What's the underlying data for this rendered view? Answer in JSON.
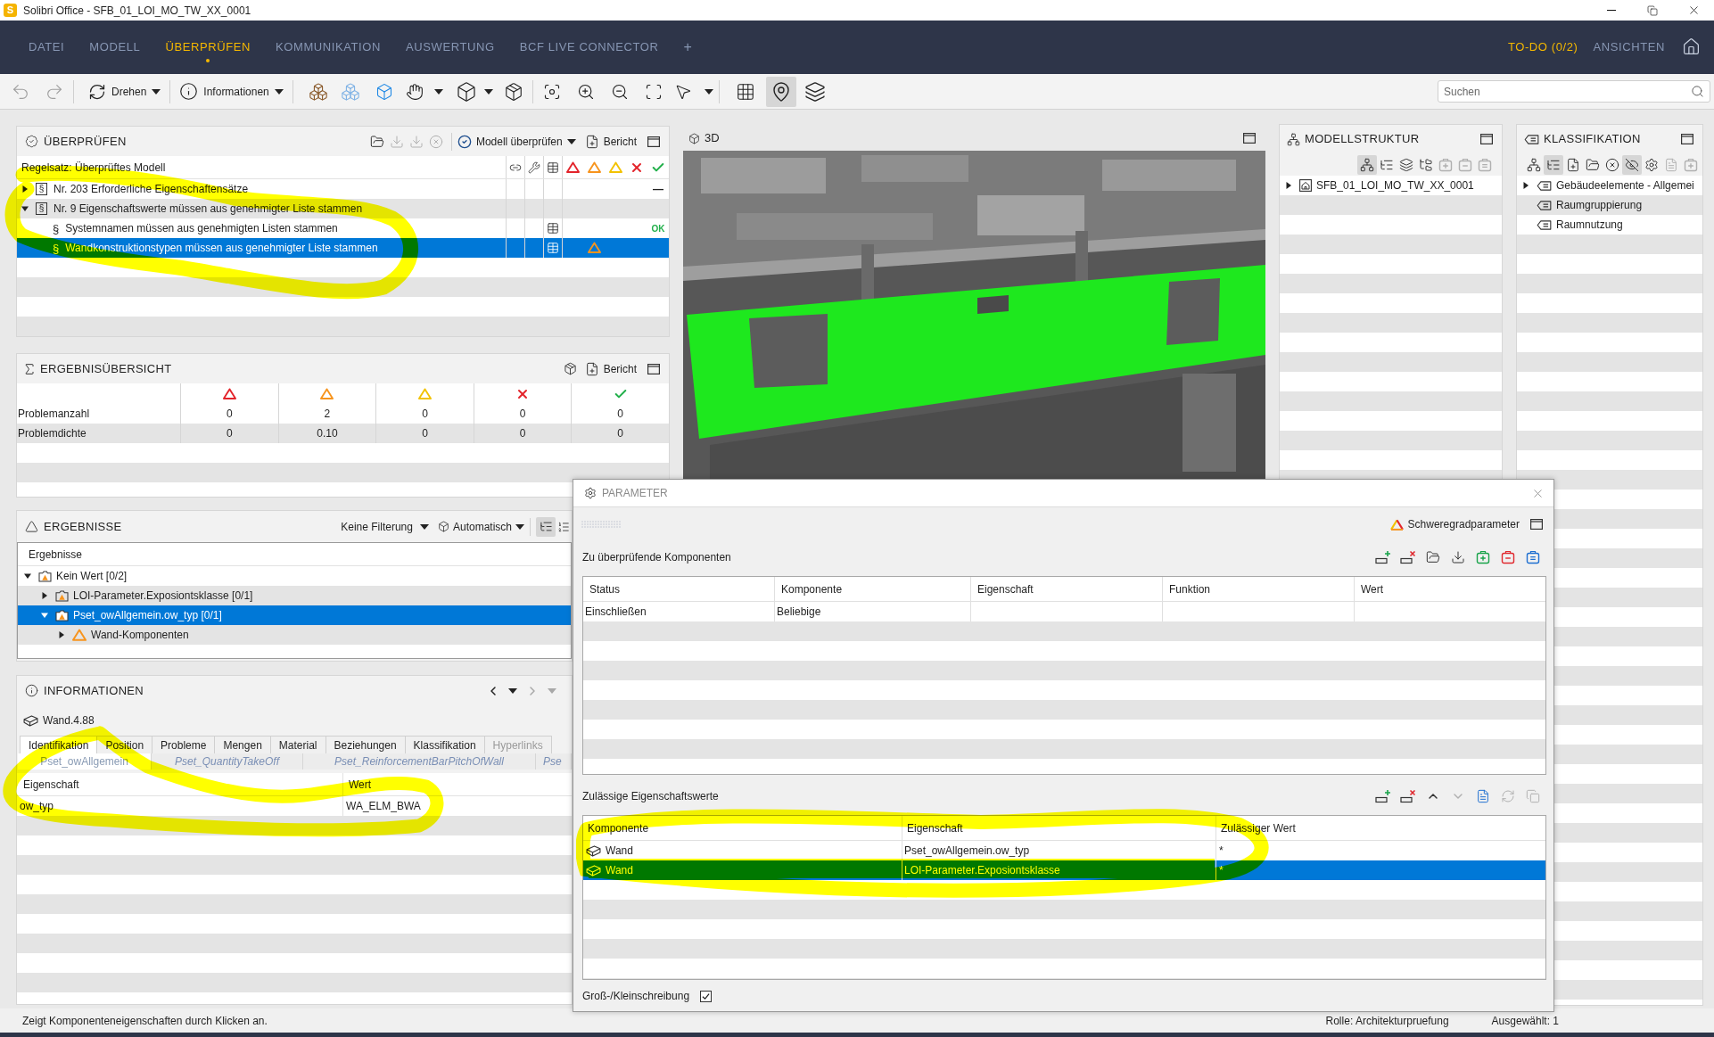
{
  "window": {
    "logo": "S",
    "title": "Solibri Office - SFB_01_LOI_MO_TW_XX_0001"
  },
  "nav": {
    "tabs": [
      {
        "label": "DATEI",
        "selected": false
      },
      {
        "label": "MODELL",
        "selected": false
      },
      {
        "label": "ÜBERPRÜFEN",
        "selected": true
      },
      {
        "label": "KOMMUNIKATION",
        "selected": false
      },
      {
        "label": "AUSWERTUNG",
        "selected": false
      },
      {
        "label": "BCF LIVE CONNECTOR",
        "selected": false
      }
    ],
    "add_tab": "+",
    "todo": "TO-DO (0/2)",
    "views": "ANSICHTEN"
  },
  "toolbar": {
    "undo_disabled": true,
    "redo_disabled": true,
    "rotate_label": "Drehen",
    "info_label": "Informationen",
    "map_view_pressed": true
  },
  "search": {
    "placeholder": "Suchen"
  },
  "check_panel": {
    "title": "ÜBERPRÜFEN",
    "tools": [
      {
        "kind": "open",
        "disabled": false
      },
      {
        "kind": "import",
        "disabled": true
      },
      {
        "kind": "export",
        "disabled": true
      },
      {
        "kind": "clear",
        "disabled": true
      }
    ],
    "run_label": "Modell überprüfen",
    "report_label": "Bericht",
    "ruleset_label": "Regelsatz: Überprüftes Modell",
    "rules": [
      {
        "kind": "ruleset",
        "symbol": "§",
        "label": "Nr. 203 Erforderliche Eigenschaftensätze",
        "expanded": false,
        "selected": false,
        "result": "—",
        "passed": false
      },
      {
        "kind": "ruleset",
        "symbol": "§",
        "label": "Nr. 9 Eigenschaftswerte müssen aus genehmigter Liste stammen",
        "expanded": true,
        "selected": false,
        "children": [
          {
            "kind": "rule",
            "symbol": "§",
            "label": "Systemnamen müssen aus genehmigten Listen stammen",
            "selected": false,
            "result": "OK",
            "passed": true
          },
          {
            "kind": "rule",
            "symbol": "§",
            "label": "Wandkonstruktionstypen müssen aus genehmigter Liste stammen",
            "selected": true,
            "marks": [
              {
                "kind": "moderate"
              }
            ]
          }
        ]
      }
    ]
  },
  "summary_panel": {
    "title": "ERGEBNISÜBERSICHT",
    "report_label": "Bericht",
    "rows": [
      {
        "label": "Problemanzahl",
        "values": [
          "0",
          "2",
          "0",
          "0",
          "0"
        ]
      },
      {
        "label": "Problemdichte",
        "values": [
          "0",
          "0.10",
          "0",
          "0",
          "0"
        ]
      }
    ]
  },
  "results_panel": {
    "title": "ERGEBNISSE",
    "filter": "Keine Filterung",
    "mode": "Automatisch",
    "tree_view_pressed": true,
    "tree_header": "Ergebnisse",
    "items": [
      {
        "kind": "category",
        "label": "Kein Wert [0/2]",
        "expanded": true,
        "selected": false,
        "children": [
          {
            "kind": "category",
            "label": "LOI-Parameter.Exposiontsklasse [0/1]",
            "expanded": false,
            "selected": false
          },
          {
            "kind": "category",
            "label": "Pset_owAllgemein.ow_typ [0/1]",
            "expanded": true,
            "selected": true,
            "children": [
              {
                "kind": "issue",
                "label": "Wand-Komponenten",
                "expanded": false,
                "selected": false
              }
            ]
          }
        ]
      }
    ]
  },
  "info_panel": {
    "title": "INFORMATIONEN",
    "nav": [
      {
        "kind": "back",
        "disabled": false
      },
      {
        "kind": "back-menu",
        "disabled": false
      },
      {
        "kind": "forward",
        "disabled": true
      },
      {
        "kind": "forward-menu",
        "disabled": true
      }
    ],
    "object": "Wand.4.88",
    "tabs": [
      {
        "label": "Identifikation",
        "selected": true,
        "disabled": false
      },
      {
        "label": "Position",
        "selected": false,
        "disabled": false
      },
      {
        "label": "Probleme",
        "selected": false,
        "disabled": false
      },
      {
        "label": "Mengen",
        "selected": false,
        "disabled": false
      },
      {
        "label": "Material",
        "selected": false,
        "disabled": false
      },
      {
        "label": "Beziehungen",
        "selected": false,
        "disabled": false
      },
      {
        "label": "Klassifikation",
        "selected": false,
        "disabled": false
      },
      {
        "label": "Hyperlinks",
        "selected": false,
        "disabled": true
      }
    ],
    "property_sets": [
      {
        "label": "Pset_owAllgemein",
        "selected": true
      },
      {
        "label": "Pset_QuantityTakeOff",
        "selected": false
      },
      {
        "label": "Pset_ReinforcementBarPitchOfWall",
        "selected": false
      },
      {
        "label": "Pse",
        "selected": false
      }
    ],
    "columns": [
      "Eigenschaft",
      "Wert"
    ],
    "rows": [
      [
        "ow_typ",
        "WA_ELM_BWA"
      ]
    ]
  },
  "view_3d": {
    "title": "3D"
  },
  "model_tree": {
    "title": "MODELLSTRUKTUR",
    "tools": [
      {
        "kind": "hierarchy",
        "pressed": true,
        "disabled": false
      },
      {
        "kind": "tree",
        "pressed": false,
        "disabled": false
      },
      {
        "kind": "layers",
        "pressed": false,
        "disabled": false
      },
      {
        "kind": "filter",
        "pressed": false,
        "disabled": false
      },
      {
        "kind": "add",
        "pressed": false,
        "disabled": true
      },
      {
        "kind": "remove",
        "pressed": false,
        "disabled": true
      },
      {
        "kind": "equal",
        "pressed": false,
        "disabled": true
      }
    ],
    "items": [
      {
        "label": "SFB_01_LOI_MO_TW_XX_0001",
        "expanded": false
      }
    ]
  },
  "classification": {
    "title": "KLASSIFIKATION",
    "tools": [
      {
        "kind": "hierarchy",
        "pressed": false,
        "disabled": false
      },
      {
        "kind": "tree",
        "pressed": true,
        "disabled": false
      },
      {
        "kind": "new",
        "pressed": false,
        "disabled": false
      },
      {
        "kind": "open",
        "pressed": false,
        "disabled": false
      },
      {
        "kind": "clear",
        "pressed": false,
        "disabled": false
      },
      {
        "kind": "hide",
        "pressed": true,
        "disabled": false
      },
      {
        "kind": "settings",
        "pressed": false,
        "disabled": false
      },
      {
        "kind": "edit",
        "pressed": false,
        "disabled": true
      },
      {
        "kind": "add",
        "pressed": false,
        "disabled": true
      }
    ],
    "items": [
      {
        "label": "Gebäudeelemente - Allgemei",
        "expandable": true
      },
      {
        "label": "Raumgruppierung",
        "expandable": false
      },
      {
        "label": "Raumnutzung",
        "expandable": false
      }
    ]
  },
  "parameter_dialog": {
    "title": "PARAMETER",
    "severity_label": "Schweregradparameter",
    "components": {
      "label": "Zu überprüfende Komponenten",
      "tools": [
        {
          "kind": "add-row",
          "disabled": false
        },
        {
          "kind": "remove-row",
          "disabled": false
        },
        {
          "kind": "open",
          "disabled": false
        },
        {
          "kind": "import",
          "disabled": false
        },
        {
          "kind": "add-item",
          "disabled": false
        },
        {
          "kind": "remove-item",
          "disabled": false
        },
        {
          "kind": "reset-item",
          "disabled": false
        }
      ],
      "columns": [
        "Status",
        "Komponente",
        "Eigenschaft",
        "Funktion",
        "Wert"
      ],
      "rows": [
        {
          "cells": [
            "Einschließen",
            "Beliebige"
          ]
        }
      ]
    },
    "allowed_values": {
      "label": "Zulässige Eigenschaftswerte",
      "tools": [
        {
          "kind": "add-row",
          "disabled": false
        },
        {
          "kind": "remove-row",
          "disabled": false
        },
        {
          "kind": "up",
          "disabled": false
        },
        {
          "kind": "down",
          "disabled": true
        },
        {
          "kind": "export-file",
          "disabled": false
        },
        {
          "kind": "refresh",
          "disabled": true
        },
        {
          "kind": "copy",
          "disabled": true
        }
      ],
      "columns": [
        "Komponente",
        "Eigenschaft",
        "Zulässiger Wert"
      ],
      "rows": [
        {
          "component": "Wand",
          "property": "Pset_owAllgemein.ow_typ",
          "value": "*",
          "selected": false
        },
        {
          "component": "Wand",
          "property": "LOI-Parameter.Exposiontsklasse",
          "value": "*",
          "selected": true
        }
      ]
    },
    "case_sensitive": {
      "label": "Groß-/Kleinschreibung",
      "checked": true
    }
  },
  "status_bar": {
    "hint": "Zeigt Komponenteneigenschaften durch Klicken an.",
    "role": "Rolle: Architekturpruefung",
    "selection": "Ausgewählt: 1"
  }
}
